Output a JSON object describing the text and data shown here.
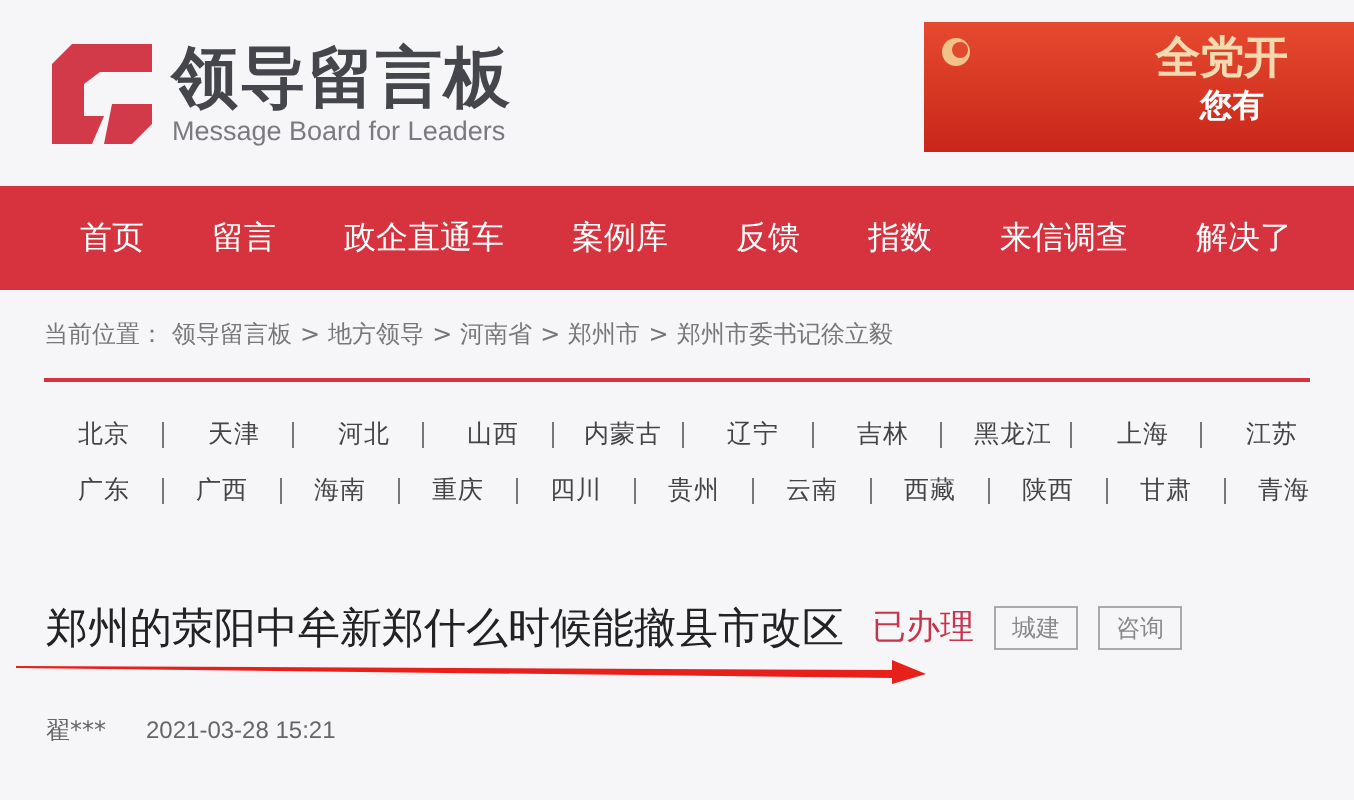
{
  "site": {
    "title": "领导留言板",
    "subtitle": "Message Board for Leaders"
  },
  "banner": {
    "headline": "全党开",
    "subline": "您有"
  },
  "nav": [
    {
      "label": "首页"
    },
    {
      "label": "留言"
    },
    {
      "label": "政企直通车"
    },
    {
      "label": "案例库"
    },
    {
      "label": "反馈"
    },
    {
      "label": "指数"
    },
    {
      "label": "来信调查"
    },
    {
      "label": "解决了"
    }
  ],
  "breadcrumb": {
    "prefix": "当前位置：",
    "items": [
      "领导留言板",
      "地方领导",
      "河南省",
      "郑州市",
      "郑州市委书记徐立毅"
    ],
    "separator": ">"
  },
  "regions": [
    [
      "北京",
      "天津",
      "河北",
      "山西",
      "内蒙古",
      "辽宁",
      "吉林",
      "黑龙江",
      "上海",
      "江苏"
    ],
    [
      "广东",
      "广西",
      "海南",
      "重庆",
      "四川",
      "贵州",
      "云南",
      "西藏",
      "陕西",
      "甘肃",
      "青海"
    ]
  ],
  "message": {
    "title": "郑州的荥阳中牟新郑什么时候能撤县市改区",
    "status": "已办理",
    "tags": [
      "城建",
      "咨询"
    ],
    "author": "翟***",
    "date": "2021-03-28 15:21"
  }
}
